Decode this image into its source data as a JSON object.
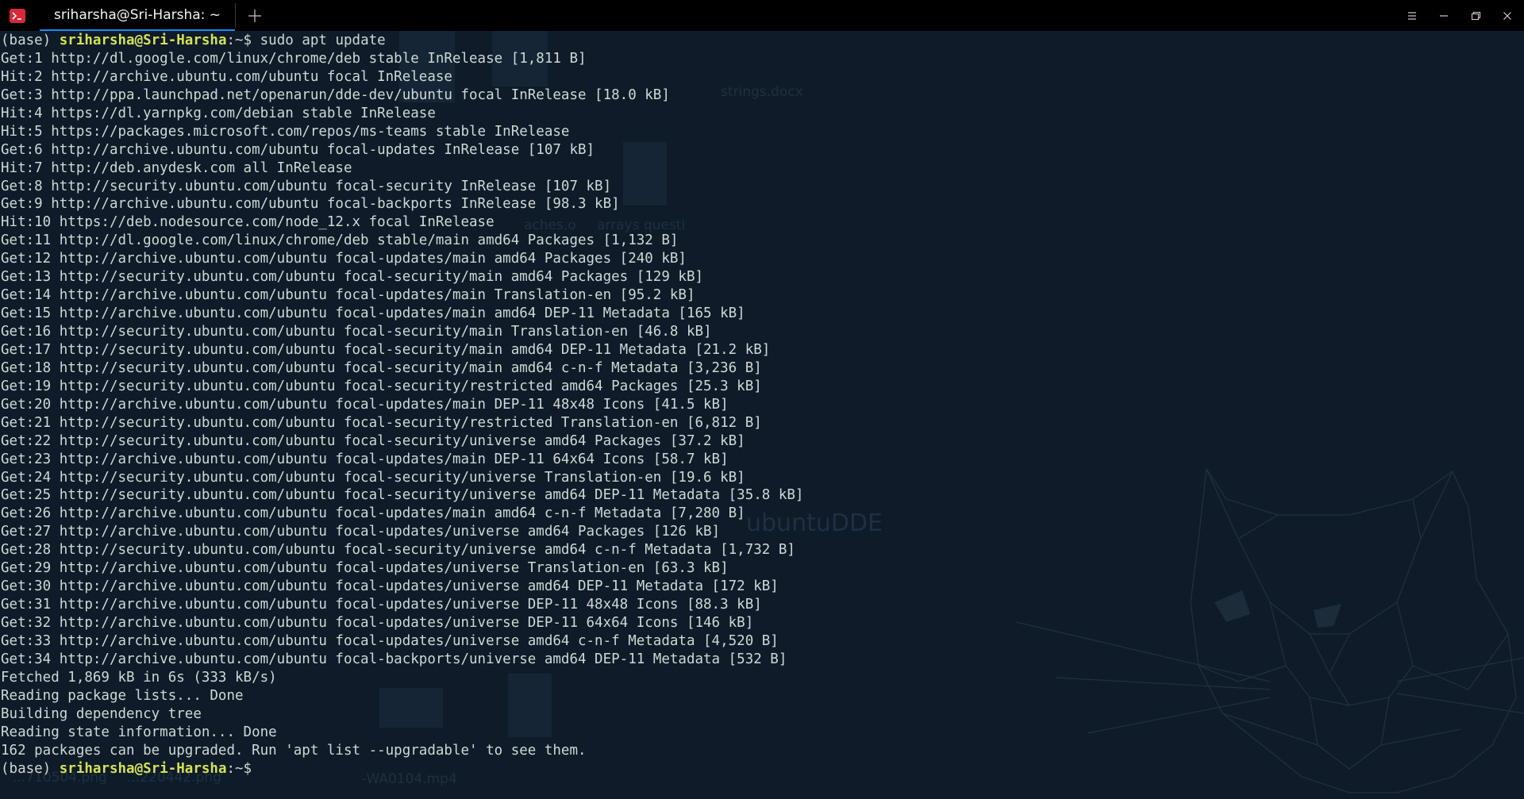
{
  "window": {
    "tab_title": "sriharsha@Sri-Harsha: ~",
    "icons": [
      "terminal-icon",
      "new-tab-icon",
      "menu-icon",
      "minimize-icon",
      "maximize-icon",
      "close-icon"
    ]
  },
  "colors": {
    "background": "#0f1b29",
    "text": "#cfd8d3",
    "prompt_user": "#d4e157",
    "tab_accent": "#1c8ef0",
    "app_icon": "#d6293a"
  },
  "terminal": {
    "prompt1": {
      "env": "(base) ",
      "user_host": "sriharsha@Sri-Harsha",
      "suffix": ":~$ ",
      "command": "sudo apt update"
    },
    "lines": [
      "Get:1 http://dl.google.com/linux/chrome/deb stable InRelease [1,811 B]",
      "Hit:2 http://archive.ubuntu.com/ubuntu focal InRelease",
      "Get:3 http://ppa.launchpad.net/openarun/dde-dev/ubuntu focal InRelease [18.0 kB]",
      "Hit:4 https://dl.yarnpkg.com/debian stable InRelease",
      "Hit:5 https://packages.microsoft.com/repos/ms-teams stable InRelease",
      "Get:6 http://archive.ubuntu.com/ubuntu focal-updates InRelease [107 kB]",
      "Hit:7 http://deb.anydesk.com all InRelease",
      "Get:8 http://security.ubuntu.com/ubuntu focal-security InRelease [107 kB]",
      "Get:9 http://archive.ubuntu.com/ubuntu focal-backports InRelease [98.3 kB]",
      "Hit:10 https://deb.nodesource.com/node_12.x focal InRelease",
      "Get:11 http://dl.google.com/linux/chrome/deb stable/main amd64 Packages [1,132 B]",
      "Get:12 http://archive.ubuntu.com/ubuntu focal-updates/main amd64 Packages [240 kB]",
      "Get:13 http://security.ubuntu.com/ubuntu focal-security/main amd64 Packages [129 kB]",
      "Get:14 http://archive.ubuntu.com/ubuntu focal-updates/main Translation-en [95.2 kB]",
      "Get:15 http://archive.ubuntu.com/ubuntu focal-updates/main amd64 DEP-11 Metadata [165 kB]",
      "Get:16 http://security.ubuntu.com/ubuntu focal-security/main Translation-en [46.8 kB]",
      "Get:17 http://security.ubuntu.com/ubuntu focal-security/main amd64 DEP-11 Metadata [21.2 kB]",
      "Get:18 http://security.ubuntu.com/ubuntu focal-security/main amd64 c-n-f Metadata [3,236 B]",
      "Get:19 http://security.ubuntu.com/ubuntu focal-security/restricted amd64 Packages [25.3 kB]",
      "Get:20 http://archive.ubuntu.com/ubuntu focal-updates/main DEP-11 48x48 Icons [41.5 kB]",
      "Get:21 http://security.ubuntu.com/ubuntu focal-security/restricted Translation-en [6,812 B]",
      "Get:22 http://security.ubuntu.com/ubuntu focal-security/universe amd64 Packages [37.2 kB]",
      "Get:23 http://archive.ubuntu.com/ubuntu focal-updates/main DEP-11 64x64 Icons [58.7 kB]",
      "Get:24 http://security.ubuntu.com/ubuntu focal-security/universe Translation-en [19.6 kB]",
      "Get:25 http://security.ubuntu.com/ubuntu focal-security/universe amd64 DEP-11 Metadata [35.8 kB]",
      "Get:26 http://archive.ubuntu.com/ubuntu focal-updates/main amd64 c-n-f Metadata [7,280 B]",
      "Get:27 http://archive.ubuntu.com/ubuntu focal-updates/universe amd64 Packages [126 kB]",
      "Get:28 http://security.ubuntu.com/ubuntu focal-security/universe amd64 c-n-f Metadata [1,732 B]",
      "Get:29 http://archive.ubuntu.com/ubuntu focal-updates/universe Translation-en [63.3 kB]",
      "Get:30 http://archive.ubuntu.com/ubuntu focal-updates/universe amd64 DEP-11 Metadata [172 kB]",
      "Get:31 http://archive.ubuntu.com/ubuntu focal-updates/universe DEP-11 48x48 Icons [88.3 kB]",
      "Get:32 http://archive.ubuntu.com/ubuntu focal-updates/universe DEP-11 64x64 Icons [146 kB]",
      "Get:33 http://archive.ubuntu.com/ubuntu focal-updates/universe amd64 c-n-f Metadata [4,520 B]",
      "Get:34 http://archive.ubuntu.com/ubuntu focal-backports/universe amd64 DEP-11 Metadata [532 B]",
      "Fetched 1,869 kB in 6s (333 kB/s)",
      "Reading package lists... Done",
      "Building dependency tree",
      "Reading state information... Done",
      "162 packages can be upgraded. Run 'apt list --upgradable' to see them."
    ],
    "prompt2": {
      "env": "(base) ",
      "user_host": "sriharsha@Sri-Harsha",
      "suffix": ":~$ ",
      "command": ""
    }
  },
  "wallpaper": {
    "desktop_labels": [
      "strings.docx",
      "aches.o",
      "arrays questi",
      "ubuntuDDE",
      "-WA0104.mp4",
      "...710504.png",
      "...220442.png"
    ]
  }
}
